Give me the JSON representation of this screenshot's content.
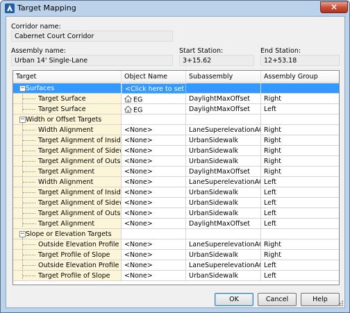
{
  "window": {
    "title": "Target Mapping",
    "close_glyph": "×"
  },
  "corridor": {
    "label": "Corridor name:",
    "value": "Cabernet Court Corridor"
  },
  "assembly": {
    "label": "Assembly name:",
    "value": "Urban 14' Single-Lane"
  },
  "start_station": {
    "label": "Start Station:",
    "value": "3+15.62"
  },
  "end_station": {
    "label": "End Station:",
    "value": "12+53.18"
  },
  "columns": [
    "Target",
    "Object Name",
    "Subassembly",
    "Assembly Group"
  ],
  "rows": [
    {
      "target": "Surfaces",
      "object": "<Click here to set all>",
      "sub": "",
      "group": ""
    },
    {
      "target": "Target Surface",
      "object": "EG",
      "sub": "DaylightMaxOffset",
      "group": "Right"
    },
    {
      "target": "Target Surface",
      "object": "EG",
      "sub": "DaylightMaxOffset",
      "group": "Left"
    },
    {
      "target": "Width or Offset Targets",
      "object": "",
      "sub": "",
      "group": ""
    },
    {
      "target": "Width Alignment",
      "object": "<None>",
      "sub": "LaneSuperelevationAOR",
      "group": "Right"
    },
    {
      "target": "Target Alignment of Inside ...",
      "object": "<None>",
      "sub": "UrbanSidewalk",
      "group": "Right"
    },
    {
      "target": "Target Alignment of Sidewal...",
      "object": "<None>",
      "sub": "UrbanSidewalk",
      "group": "Right"
    },
    {
      "target": "Target Alignment of Outsid...",
      "object": "<None>",
      "sub": "UrbanSidewalk",
      "group": "Right"
    },
    {
      "target": "Target Alignment",
      "object": "<None>",
      "sub": "DaylightMaxOffset",
      "group": "Right"
    },
    {
      "target": "Width Alignment",
      "object": "<None>",
      "sub": "LaneSuperelevationAOR",
      "group": "Left"
    },
    {
      "target": "Target Alignment of Inside ...",
      "object": "<None>",
      "sub": "UrbanSidewalk",
      "group": "Left"
    },
    {
      "target": "Target Alignment of Sidewal...",
      "object": "<None>",
      "sub": "UrbanSidewalk",
      "group": "Left"
    },
    {
      "target": "Target Alignment of Outsid...",
      "object": "<None>",
      "sub": "UrbanSidewalk",
      "group": "Left"
    },
    {
      "target": "Target Alignment",
      "object": "<None>",
      "sub": "DaylightMaxOffset",
      "group": "Left"
    },
    {
      "target": "Slope or Elevation Targets",
      "object": "",
      "sub": "",
      "group": ""
    },
    {
      "target": "Outside Elevation Profile",
      "object": "<None>",
      "sub": "LaneSuperelevationAOR",
      "group": "Right"
    },
    {
      "target": "Target Profile of Slope",
      "object": "<None>",
      "sub": "UrbanSidewalk",
      "group": "Right"
    },
    {
      "target": "Outside Elevation Profile",
      "object": "<None>",
      "sub": "LaneSuperelevationAOR",
      "group": "Left"
    },
    {
      "target": "Target Profile of Slope",
      "object": "<None>",
      "sub": "UrbanSidewalk",
      "group": "Left"
    }
  ],
  "buttons": {
    "ok": "OK",
    "cancel": "Cancel",
    "help": "Help"
  }
}
